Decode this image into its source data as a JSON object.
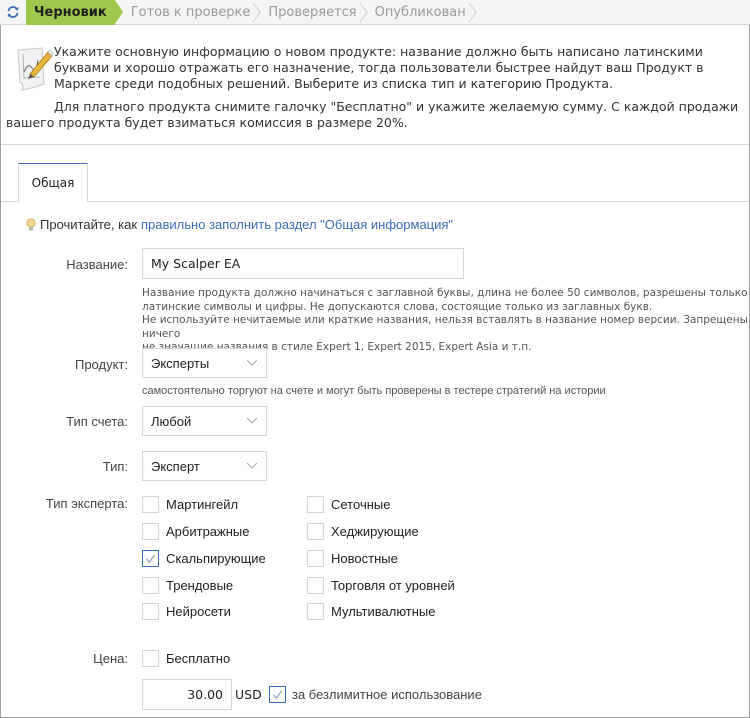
{
  "statusbar": {
    "refresh_icon": "refresh-icon",
    "steps": [
      {
        "label": "Черновик",
        "active": true
      },
      {
        "label": "Готов к проверке",
        "active": false
      },
      {
        "label": "Проверяется",
        "active": false
      },
      {
        "label": "Опубликован",
        "active": false
      }
    ]
  },
  "intro": {
    "icon": "edit-chart-icon",
    "paragraph1": "Укажите основную информацию о новом продукте: название должно быть написано латинскими буквами и хорошо отражать его назначение, тогда пользователи быстрее найдут ваш Продукт в Маркете среди подобных решений. Выберите из списка тип и категорию Продукта.",
    "paragraph2": "Для платного продукта снимите галочку \"Бесплатно\" и укажите желаемую сумму. С каждой продажи вашего продукта будет взиматься комиссия в размере 20%."
  },
  "tabs": [
    {
      "label": "Общая",
      "active": true
    }
  ],
  "tip": {
    "icon": "lightbulb-icon",
    "text": "Прочитайте, как",
    "link": "правильно заполнить раздел \"Общая информация\""
  },
  "form": {
    "name": {
      "label": "Название:",
      "value": "My Scalper EA",
      "hint_line1": "Название продукта должно начинаться с заглавной буквы, длина не более 50 символов, разрешены только",
      "hint_line2": "латинские символы и цифры. Не допускаются слова, состоящие только из заглавных букв.",
      "hint_line3": "Не используйте нечитаемые или краткие названия, нельзя вставлять в название номер версии. Запрещены ничего",
      "hint_line4": "не значащие названия в стиле Expert 1, Expert 2015, Expert Asia и т.п."
    },
    "product": {
      "label": "Продукт:",
      "value": "Эксперты",
      "hint": "самостоятельно торгуют на счете и могут быть проверены в тестере стратегий на истории"
    },
    "account_type": {
      "label": "Тип счета:",
      "value": "Любой"
    },
    "type": {
      "label": "Тип:",
      "value": "Эксперт"
    },
    "expert_type": {
      "label": "Тип эксперта:",
      "options": [
        {
          "label": "Мартингейл",
          "checked": false
        },
        {
          "label": "Сеточные",
          "checked": false
        },
        {
          "label": "Арбитражные",
          "checked": false
        },
        {
          "label": "Хеджирующие",
          "checked": false
        },
        {
          "label": "Скальпирующие",
          "checked": true
        },
        {
          "label": "Новостные",
          "checked": false
        },
        {
          "label": "Трендовые",
          "checked": false
        },
        {
          "label": "Торговля от уровней",
          "checked": false
        },
        {
          "label": "Нейросети",
          "checked": false
        },
        {
          "label": "Мультивалютные",
          "checked": false
        }
      ]
    },
    "price": {
      "label": "Цена:",
      "free_label": "Бесплатно",
      "free_checked": false,
      "value": "30.00",
      "currency": "USD",
      "unlimited_label": "за безлимитное использование",
      "unlimited_checked": true
    }
  },
  "colors": {
    "active_step": "#9cc94b",
    "accent": "#3d6cb7",
    "border": "#d6d6d6"
  }
}
